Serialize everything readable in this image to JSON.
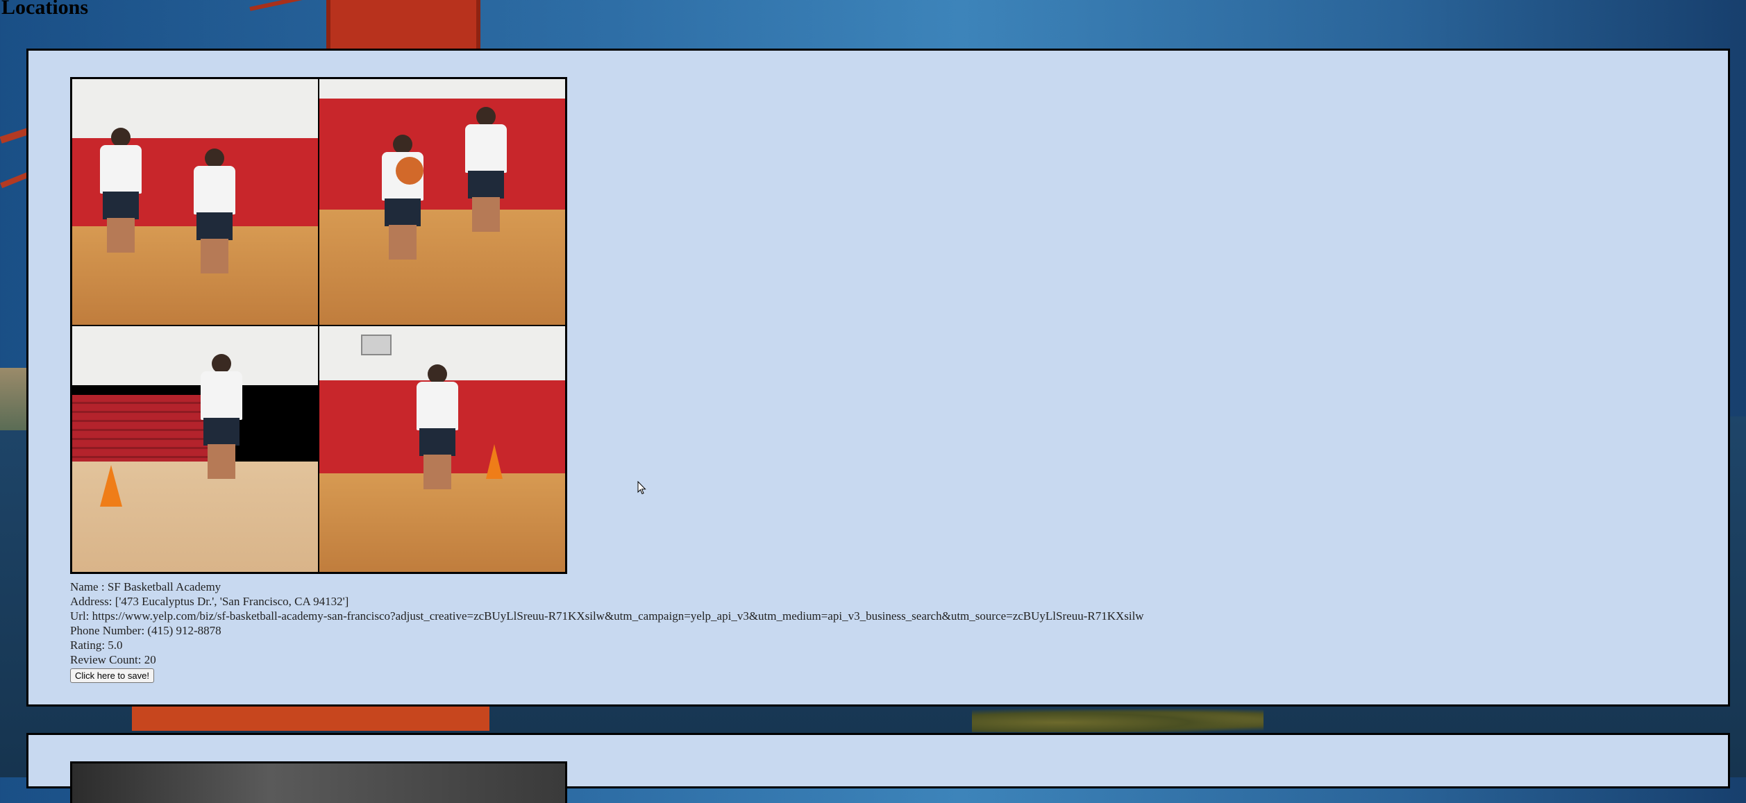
{
  "page": {
    "title": "Locations"
  },
  "locations": [
    {
      "name_line": "Name : SF Basketball Academy",
      "address_line": "Address: ['473 Eucalyptus Dr.', 'San Francisco, CA 94132']",
      "url_line": "Url: https://www.yelp.com/biz/sf-basketball-academy-san-francisco?adjust_creative=zcBUyLlSreuu-R71KXsilw&utm_campaign=yelp_api_v3&utm_medium=api_v3_business_search&utm_source=zcBUyLlSreuu-R71KXsilw",
      "phone_line": "Phone Number: (415) 912-8878",
      "rating_line": "Rating: 5.0",
      "review_line": "Review Count: 20",
      "save_label": "Click here to save!"
    }
  ]
}
